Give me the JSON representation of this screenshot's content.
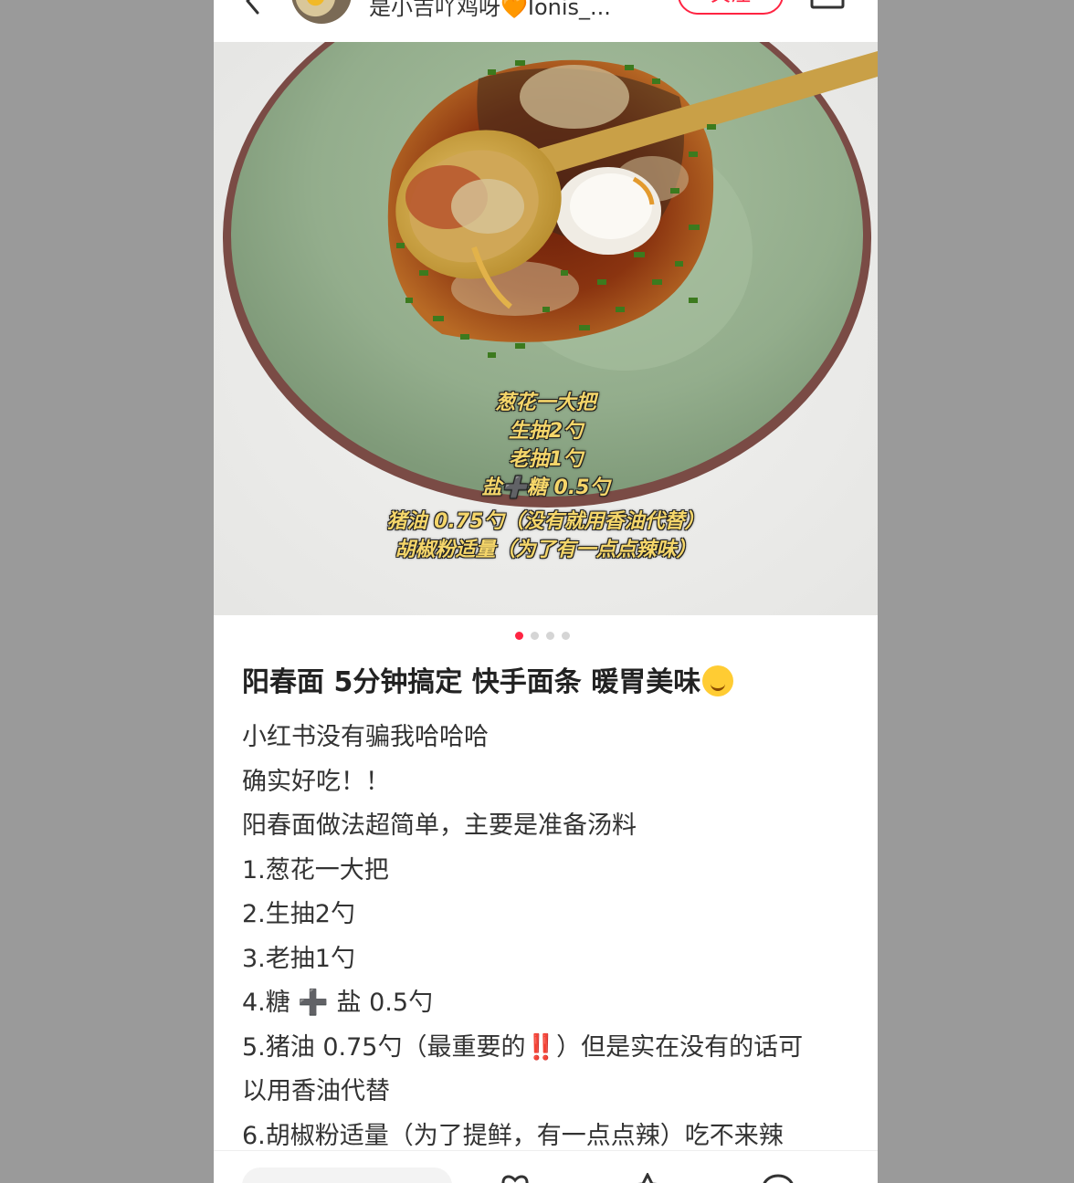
{
  "header": {
    "author_name": "是小吉吖鸡呀🧡Ionis_...",
    "follow_label": "关注"
  },
  "photo_overlay": {
    "lines": [
      "葱花一大把",
      "生抽2勺",
      "老抽1勺",
      "盐➕糖 0.5勺",
      "猪油 0.75勺（没有就用香油代替）",
      "胡椒粉适量（为了有一点点辣味）"
    ]
  },
  "carousel": {
    "total": 4,
    "active": 1
  },
  "post": {
    "title": "阳春面 5分钟搞定 快手面条 暖胃美味",
    "body": [
      "小红书没有骗我哈哈哈",
      "确实好吃！！",
      "阳春面做法超简单，主要是准备汤料",
      "1.葱花一大把",
      "2.生抽2勺",
      "3.老抽1勺",
      "4.糖 ➕ 盐 0.5勺",
      "5.猪油 0.75勺（最重要的‼️）但是实在没有的话可",
      "以用香油代替",
      "6.胡椒粉适量（为了提鲜，有一点点辣）吃不来辣"
    ]
  },
  "colors": {
    "accent": "#ff2442",
    "overlay_text": "#f5d66a",
    "bowl_green": "#9fb89a"
  },
  "icons": {
    "back": "chevron-left-icon",
    "share": "share-icon",
    "like": "heart-icon",
    "collect": "star-icon",
    "comment": "comment-icon"
  }
}
